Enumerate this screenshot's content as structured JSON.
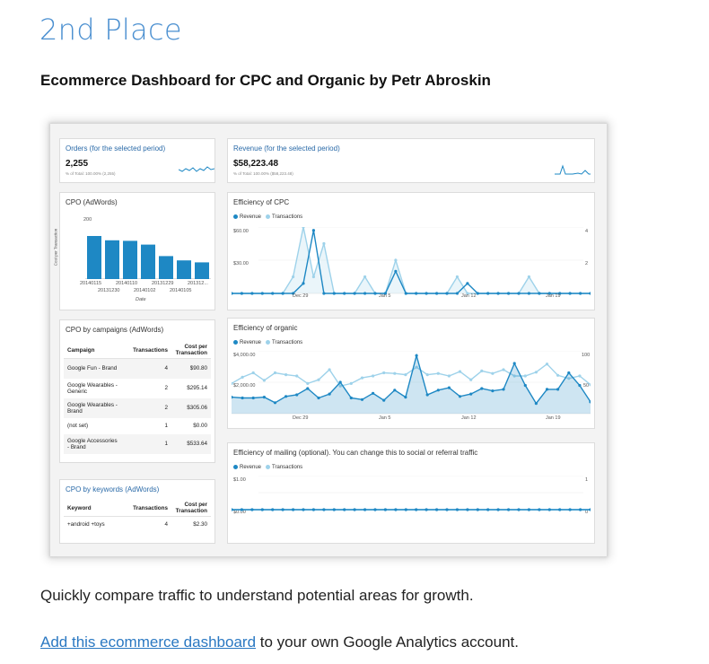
{
  "page": {
    "place": "2nd Place",
    "heading": "Ecommerce Dashboard for CPC and Organic by Petr Abroskin",
    "caption": "Quickly compare traffic to understand potential areas for growth.",
    "link_text": "Add this ecommerce dashboard",
    "link_suffix": " to your own Google Analytics account."
  },
  "colors": {
    "accent_blue": "#4a8fd0",
    "revenue": "#1e88c4",
    "transactions": "#9ed2ea",
    "link": "#2a78c2"
  },
  "orders": {
    "title": "Orders (for the selected period)",
    "value": "2,255",
    "sub": "% of Total: 100.00% (2,255)"
  },
  "revenue_panel": {
    "title": "Revenue (for the selected period)",
    "value": "$58,223.48",
    "sub": "% of Total: 100.00% ($58,223.48)"
  },
  "cpo_adwords": {
    "title": "CPO (AdWords)",
    "y_label": "Cost per Transaction",
    "x_label": "Date",
    "y_top": "200",
    "dates_row1": [
      "20140115",
      "20140110",
      "20131229",
      "201312..."
    ],
    "dates_row2": [
      "20131230",
      "20140102",
      "20140105"
    ]
  },
  "cpo_campaigns": {
    "title": "CPO by campaigns (AdWords)",
    "headers": [
      "Campaign",
      "Transactions",
      "Cost per Transaction"
    ],
    "rows": [
      {
        "campaign": "Google Fun - Brand",
        "transactions": "4",
        "cost": "$90.80"
      },
      {
        "campaign": "Google Wearables - Generic",
        "transactions": "2",
        "cost": "$295.14"
      },
      {
        "campaign": "Google Wearables - Brand",
        "transactions": "2",
        "cost": "$305.06"
      },
      {
        "campaign": "(not set)",
        "transactions": "1",
        "cost": "$0.00"
      },
      {
        "campaign": "Google Accessories - Brand",
        "transactions": "1",
        "cost": "$533.64"
      }
    ]
  },
  "cpo_keywords": {
    "title": "CPO by keywords (AdWords)",
    "headers": [
      "Keyword",
      "Transactions",
      "Cost per Transaction"
    ],
    "rows": [
      {
        "keyword": "+android +toys",
        "transactions": "4",
        "cost": "$2.30"
      }
    ]
  },
  "eff_cpc": {
    "title": "Efficiency of CPC",
    "legend": [
      "Revenue",
      "Transactions"
    ],
    "y_left": [
      "$60.00",
      "$30.00"
    ],
    "y_right": [
      "4",
      "2"
    ],
    "x_ticks": [
      "Dec 29",
      "Jan 5",
      "Jan 12",
      "Jan 19"
    ]
  },
  "eff_organic": {
    "title": "Efficiency of organic",
    "legend": [
      "Revenue",
      "Transactions"
    ],
    "y_left": [
      "$4,000.00",
      "$2,000.00"
    ],
    "y_right": [
      "100",
      "50"
    ],
    "x_ticks": [
      "Dec 29",
      "Jan 5",
      "Jan 12",
      "Jan 19"
    ]
  },
  "eff_mailing": {
    "title": "Efficiency of mailing (optional). You can change this to social or referral traffic",
    "legend": [
      "Revenue",
      "Transactions"
    ],
    "y_left": [
      "$1.00",
      "$0.00"
    ],
    "y_right": [
      "1",
      "0"
    ]
  },
  "chart_data": [
    {
      "type": "bar",
      "title": "CPO (AdWords)",
      "ylabel": "Cost per Transaction",
      "xlabel": "Date",
      "ylim": [
        0,
        200
      ],
      "categories": [
        "20140115",
        "20131230",
        "20140110",
        "20140102",
        "20131229",
        "20140105",
        "201312..."
      ],
      "values": [
        150,
        135,
        133,
        120,
        80,
        65,
        58
      ]
    },
    {
      "type": "line",
      "title": "Efficiency of CPC",
      "ylim": [
        0,
        60
      ],
      "y2lim": [
        0,
        4
      ],
      "series": [
        {
          "name": "Revenue",
          "axis": "left",
          "values": [
            0,
            0,
            0,
            0,
            0,
            0,
            0,
            9,
            57,
            0,
            0,
            0,
            0,
            0,
            0,
            0,
            20,
            0,
            0,
            0,
            0,
            0,
            0,
            9,
            0,
            0,
            0,
            0,
            0,
            0,
            0,
            0,
            0,
            0,
            0,
            0
          ]
        },
        {
          "name": "Transactions",
          "axis": "right",
          "values": [
            0,
            0,
            0,
            0,
            0,
            0,
            1,
            4,
            1,
            3,
            0,
            0,
            0,
            1,
            0,
            0,
            2,
            0,
            0,
            0,
            0,
            0,
            1,
            0,
            0,
            0,
            0,
            0,
            0,
            1,
            0,
            0,
            0,
            0,
            0,
            0
          ]
        }
      ]
    },
    {
      "type": "line",
      "title": "Efficiency of organic",
      "ylim": [
        0,
        4000
      ],
      "y2lim": [
        0,
        100
      ],
      "series": [
        {
          "name": "Revenue",
          "axis": "left",
          "values": [
            1050,
            1000,
            1000,
            1050,
            700,
            1100,
            1200,
            1600,
            1000,
            1250,
            2000,
            1000,
            900,
            1300,
            850,
            1500,
            1050,
            3700,
            1200,
            1500,
            1650,
            1100,
            1250,
            1600,
            1450,
            1550,
            3200,
            1800,
            650,
            1550,
            1550,
            2600,
            1800,
            750
          ]
        },
        {
          "name": "Transactions",
          "axis": "right",
          "values": [
            48,
            58,
            65,
            53,
            65,
            62,
            60,
            48,
            54,
            70,
            44,
            48,
            57,
            60,
            65,
            64,
            62,
            74,
            62,
            64,
            60,
            67,
            54,
            68,
            64,
            70,
            60,
            60,
            66,
            79,
            61,
            56,
            60,
            46
          ]
        }
      ]
    },
    {
      "type": "line",
      "title": "Efficiency of mailing (optional). You can change this to social or referral traffic",
      "ylim": [
        0,
        1
      ],
      "y2lim": [
        0,
        1
      ],
      "series": [
        {
          "name": "Revenue",
          "axis": "left",
          "values": [
            0,
            0,
            0,
            0,
            0,
            0,
            0,
            0,
            0,
            0,
            0,
            0,
            0,
            0,
            0,
            0,
            0,
            0,
            0,
            0,
            0,
            0,
            0,
            0,
            0,
            0,
            0,
            0,
            0,
            0,
            0,
            0,
            0,
            0,
            0,
            0
          ]
        },
        {
          "name": "Transactions",
          "axis": "right",
          "values": [
            0,
            0,
            0,
            0,
            0,
            0,
            0,
            0,
            0,
            0,
            0,
            0,
            0,
            0,
            0,
            0,
            0,
            0,
            0,
            0,
            0,
            0,
            0,
            0,
            0,
            0,
            0,
            0,
            0,
            0,
            0,
            0,
            0,
            0,
            0,
            0
          ]
        }
      ]
    }
  ]
}
